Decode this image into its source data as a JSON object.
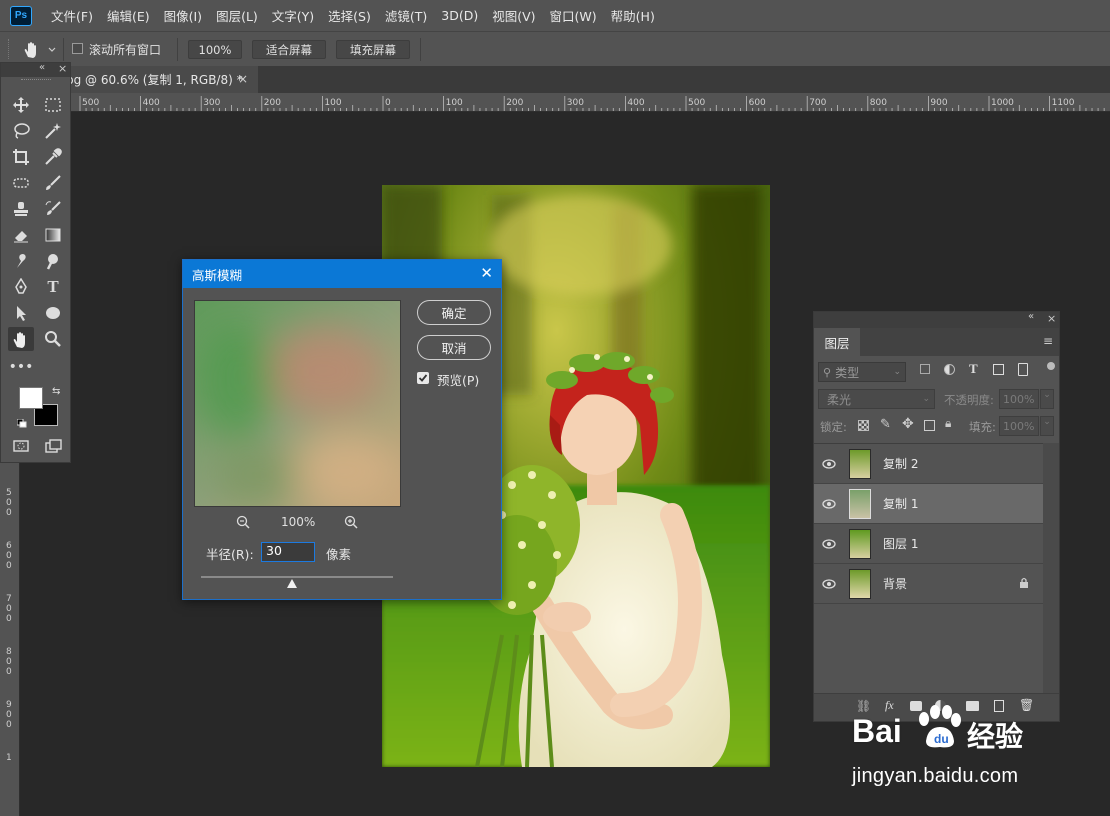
{
  "app": {
    "logo": "Ps",
    "menu": [
      "文件(F)",
      "编辑(E)",
      "图像(I)",
      "图层(L)",
      "文字(Y)",
      "选择(S)",
      "滤镜(T)",
      "3D(D)",
      "视图(V)",
      "窗口(W)",
      "帮助(H)"
    ]
  },
  "options": {
    "scroll_all_label": "滚动所有窗口",
    "zoom_value": "100%",
    "fit_screen_label": "适合屏幕",
    "fill_screen_label": "填充屏幕"
  },
  "document": {
    "tab_title": "pg @ 60.6% (复制 1, RGB/8) *",
    "tab_close": "×"
  },
  "rulers": {
    "h_labels": [
      "500",
      "400",
      "300",
      "200",
      "100",
      "0",
      "100",
      "200",
      "300",
      "400",
      "500",
      "600",
      "700",
      "800",
      "900",
      "1000",
      "1100"
    ],
    "v_labels": [
      "5",
      "0",
      "0",
      "6",
      "0",
      "0",
      "7",
      "0",
      "0",
      "8",
      "0",
      "0",
      "9",
      "0",
      "0",
      "1"
    ]
  },
  "dialog": {
    "title": "高斯模糊",
    "ok_label": "确定",
    "cancel_label": "取消",
    "preview_label": "预览(P)",
    "preview_checked": true,
    "zoom_label": "100%",
    "radius_label": "半径(R):",
    "radius_value": "30",
    "unit_label": "像素"
  },
  "layers_panel": {
    "tab_label": "图层",
    "kind_filter": "类型",
    "blend_mode": "柔光",
    "opacity_label": "不透明度:",
    "opacity_value": "100%",
    "lock_label": "锁定:",
    "fill_label": "填充:",
    "fill_value": "100%",
    "layers": [
      {
        "name": "复制 2",
        "selected": false,
        "locked": false
      },
      {
        "name": "复制 1",
        "selected": true,
        "locked": false
      },
      {
        "name": "图层 1",
        "selected": false,
        "locked": false
      },
      {
        "name": "背景",
        "selected": false,
        "locked": true
      }
    ]
  },
  "watermark": {
    "brand": "Bai",
    "brand_suffix": "经验",
    "url": "jingyan.baidu.com"
  },
  "colors": {
    "accent": "#0b78d6",
    "panel_bg": "#535353",
    "workspace_bg": "#282828"
  }
}
